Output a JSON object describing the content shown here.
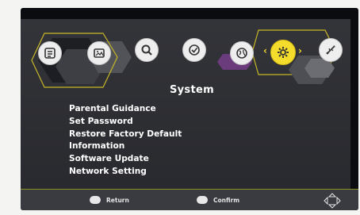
{
  "header": {
    "title": "System"
  },
  "top_icons": [
    {
      "name": "channel-list-icon",
      "active": false
    },
    {
      "name": "picture-icon",
      "active": false
    },
    {
      "name": "search-icon",
      "active": false
    },
    {
      "name": "timer-icon",
      "active": false
    },
    {
      "name": "globe-icon",
      "active": false
    },
    {
      "name": "gear-icon",
      "active": true
    },
    {
      "name": "usb-icon",
      "active": false
    }
  ],
  "menu": {
    "items": [
      "Parental Guidance",
      "Set Password",
      "Restore Factory Default",
      "Information",
      "Software Update",
      "Network Setting"
    ]
  },
  "footer": {
    "return_label": "Return",
    "confirm_label": "Confirm",
    "nav_icon": "dpad-arrows-icon"
  },
  "colors": {
    "accent": "#f3dc2b",
    "panel": "#2b2c31",
    "footer": "#3a3b40"
  }
}
